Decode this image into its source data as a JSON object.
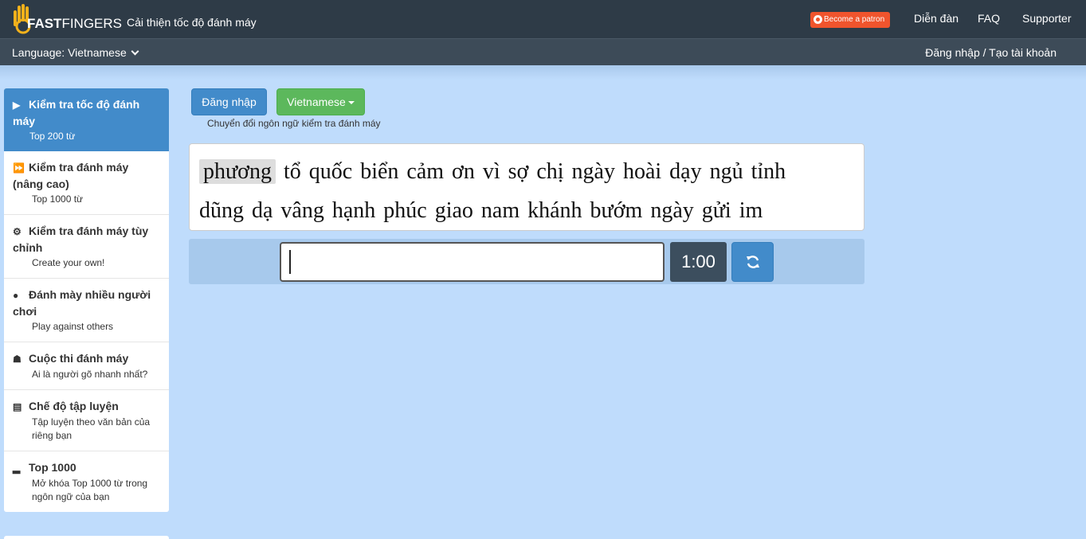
{
  "header": {
    "logo_text_bold": "FAST",
    "logo_text": "FINGERS",
    "tagline": "Cải thiện tốc độ đánh máy",
    "patron_label": "Become a patron",
    "nav": [
      "Diễn đàn",
      "FAQ",
      "Supporter"
    ]
  },
  "subbar": {
    "language_label": "Language: Vietnamese",
    "login_link": "Đăng nhập / Tạo tài khoản"
  },
  "sidebar": {
    "items": [
      {
        "title": "Kiểm tra tốc độ đánh máy",
        "sub": "Top 200 từ",
        "icon": "play-icon",
        "active": true
      },
      {
        "title": "Kiểm tra đánh máy (nâng cao)",
        "sub": "Top 1000 từ",
        "icon": "fast-forward-icon"
      },
      {
        "title": "Kiểm tra đánh máy tùy chỉnh",
        "sub": "Create your own!",
        "icon": "gears-icon"
      },
      {
        "title": "Đánh mày nhiều người chơi",
        "sub": "Play against others",
        "icon": "users-icon"
      },
      {
        "title": "Cuộc thi đánh máy",
        "sub": "Ai là người gõ nhanh nhất?",
        "icon": "trophy-icon"
      },
      {
        "title": "Chế độ tập luyện",
        "sub": "Tập luyện theo văn bản của riêng bạn",
        "icon": "document-icon"
      },
      {
        "title": "Top 1000",
        "sub": "Mở khóa Top 1000 từ trong ngôn ngữ của bạn",
        "icon": "signal-icon"
      }
    ]
  },
  "main": {
    "login_button": "Đăng nhập",
    "language_button": "Vietnamese",
    "switch_note": "Chuyển đổi ngôn ngữ kiểm tra đánh máy",
    "current_word": "phương",
    "words_line1": "tổ quốc biển cảm ơn vì sợ chị ngày hoài dạy ngủ tỉnh",
    "words_line2": "dũng dạ vâng hạnh phúc giao nam khánh bướm ngày gửi im",
    "input_value": "",
    "timer": "1:00"
  },
  "colors": {
    "navbar": "#2e3b47",
    "accent_blue": "#428bca",
    "accent_green": "#5cb85c",
    "patron": "#f0542d",
    "background": "#bfdcfc"
  }
}
